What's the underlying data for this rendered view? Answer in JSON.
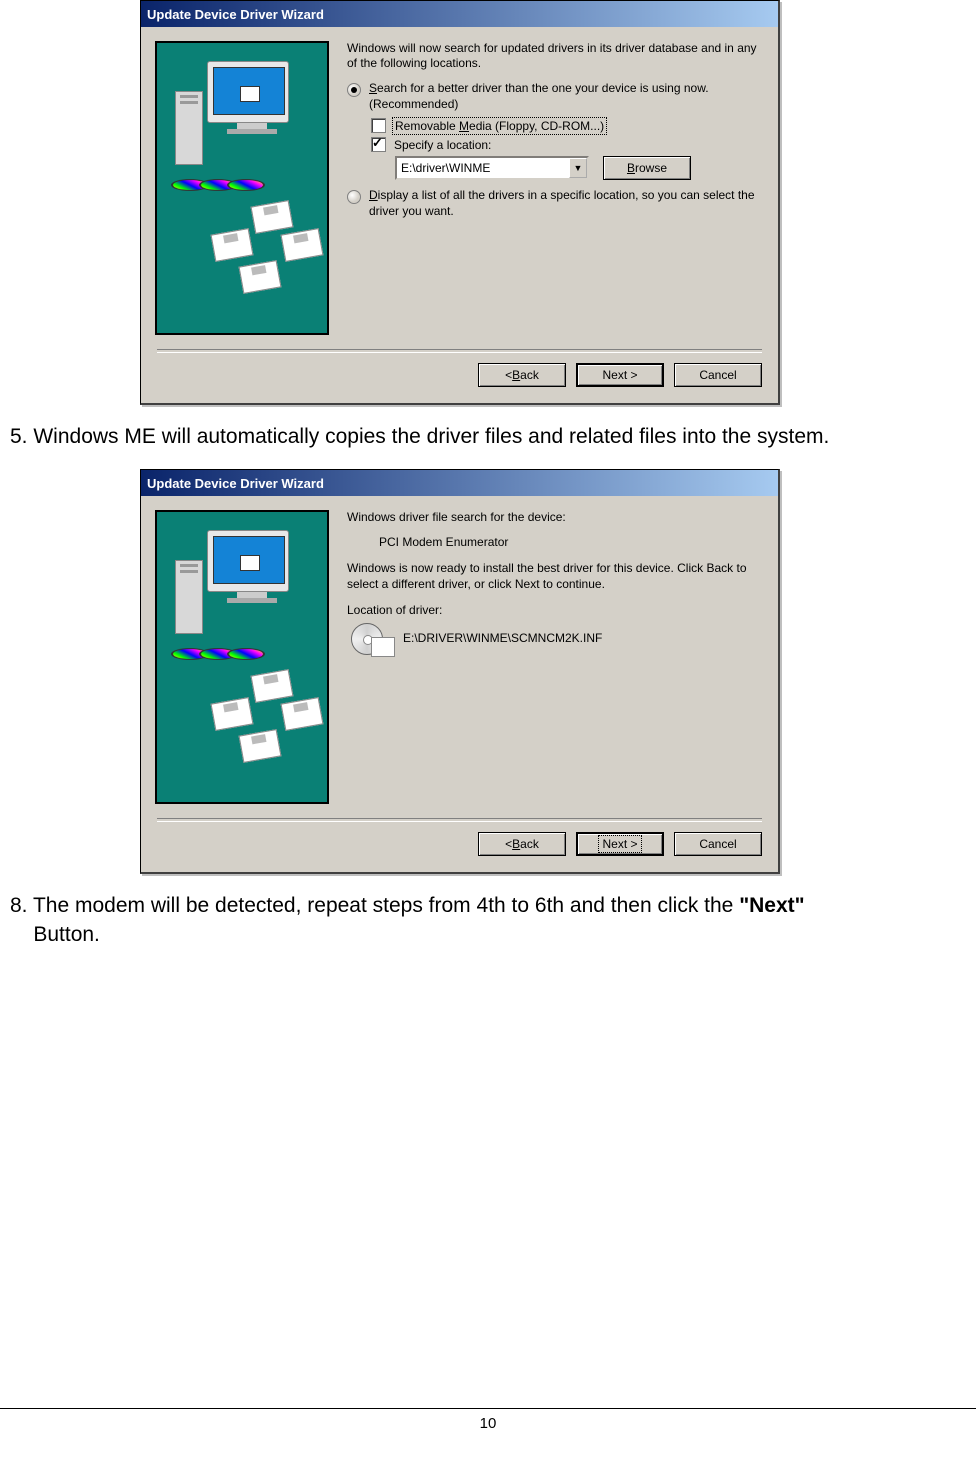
{
  "dialog1": {
    "title": "Update Device Driver Wizard",
    "intro": "Windows will now search for updated drivers in its driver database and in any of the following locations.",
    "radio1": {
      "underline": "S",
      "rest": "earch for a better driver than the one your device is using now. (Recommended)"
    },
    "opt_removable": {
      "pre": "Removable ",
      "u": "M",
      "post": "edia (Floppy, CD-ROM...)"
    },
    "opt_specify": "Specify a location:",
    "path": "E:\\driver\\WINME",
    "browse": "Browse",
    "radio2": {
      "underline": "D",
      "rest": "isplay a list of all the drivers in a specific location, so you can select the driver you want."
    },
    "back_pre": "< ",
    "back_u": "B",
    "back_post": "ack",
    "next": "Next >",
    "cancel": "Cancel"
  },
  "instruction5": "5. Windows ME will automatically copies the driver files and related files into the system.",
  "dialog2": {
    "title": "Update Device Driver Wizard",
    "search_text": "Windows driver file search for the device:",
    "device": "PCI Modem Enumerator",
    "ready_text": "Windows is now ready to install the best driver for this device. Click Back to select a different driver, or click Next to continue.",
    "loc_label": "Location of driver:",
    "driver_path": "E:\\DRIVER\\WINME\\SCMNCM2K.INF",
    "back_pre": "< ",
    "back_u": "B",
    "back_post": "ack",
    "next": "Next >",
    "cancel": "Cancel"
  },
  "instruction8_pre": "8. The modem will be detected, repeat steps from 4th to 6th and then click the ",
  "instruction8_bold": "\"Next\"",
  "instruction8_post": "Button.",
  "page_number": "10"
}
